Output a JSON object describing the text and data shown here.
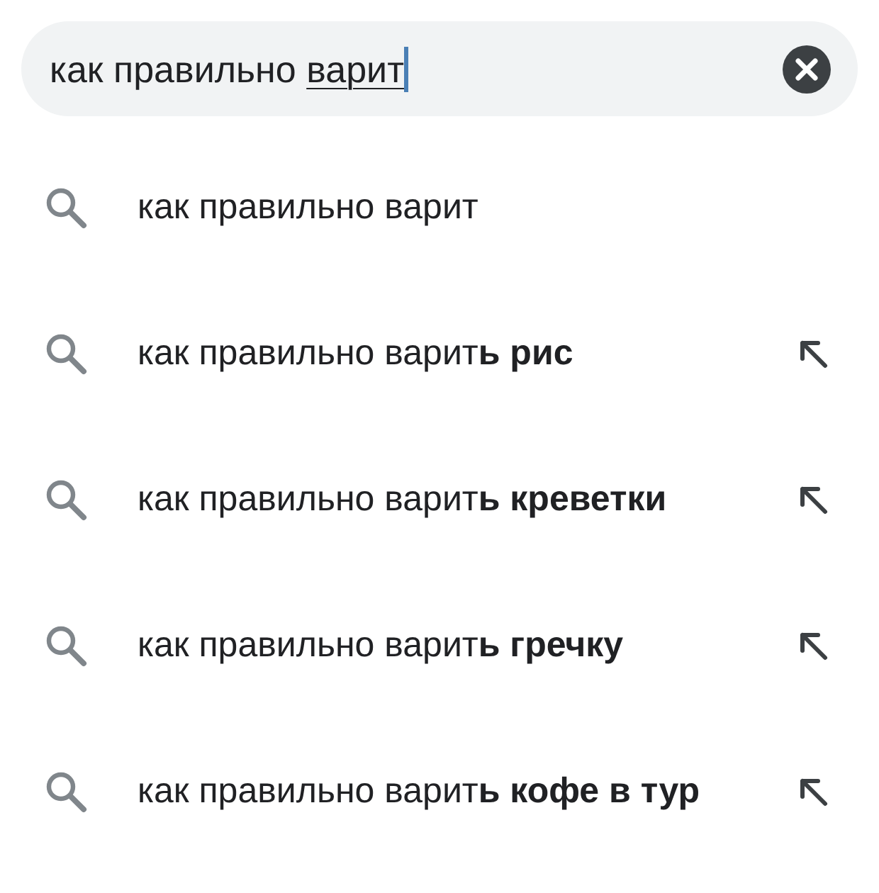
{
  "search": {
    "text": "как правильно",
    "composing": "варит"
  },
  "suggestions": [
    {
      "text": "как правильно варит",
      "fill_button": false
    },
    {
      "text": "как правильно варит**ь рис**",
      "fill_button": true
    },
    {
      "text": "как правильно варит**ь креветки**",
      "fill_button": true
    },
    {
      "text": "как правильно варит**ь гречку**",
      "fill_button": true
    },
    {
      "text": "как правильно варит**ь кофе в тур**",
      "fill_button": true
    }
  ]
}
